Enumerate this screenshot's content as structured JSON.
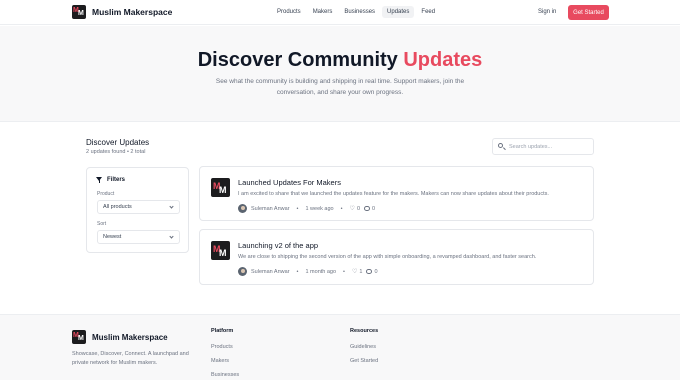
{
  "header": {
    "brand": "Muslim Makerspace",
    "nav": [
      "Products",
      "Makers",
      "Businesses",
      "Updates",
      "Feed"
    ],
    "active_nav": "Updates",
    "sign_in": "Sign in",
    "cta": "Get Started",
    "accent_color": "#e84a5f"
  },
  "hero": {
    "title_main": "Discover Community",
    "title_accent": "Updates",
    "subtitle": "See what the community is building and shipping in real time. Support makers, join the conversation, and share your own progress."
  },
  "updates": {
    "title": "Discover Updates",
    "count": "2 updates found • 2 total",
    "search_placeholder": "Search updates..."
  },
  "filters": {
    "title": "Filters",
    "product_label": "Product",
    "product_value": "All products",
    "sort_label": "Sort",
    "sort_value": "Newest"
  },
  "cards": [
    {
      "title": "Launched Updates For Makers",
      "body": "I am excited to share that we launched the updates feature for the makers. Makers can now share updates about their products.",
      "author": "Suleman Anwar",
      "time": "1 week ago",
      "likes": "0",
      "comments": "0"
    },
    {
      "title": "Launching v2 of the app",
      "body": "We are close to shipping the second version of the app with simple onboarding, a revamped dashboard, and faster search.",
      "author": "Suleman Anwar",
      "time": "1 month ago",
      "likes": "1",
      "comments": "0"
    }
  ],
  "footer": {
    "brand": "Muslim Makerspace",
    "description": "Showcase, Discover, Connect. A launchpad and private network for Muslim makers.",
    "platform_title": "Platform",
    "platform_links": [
      "Products",
      "Makers",
      "Businesses"
    ],
    "resources_title": "Resources",
    "resources_links": [
      "Guidelines",
      "Get Started"
    ]
  }
}
